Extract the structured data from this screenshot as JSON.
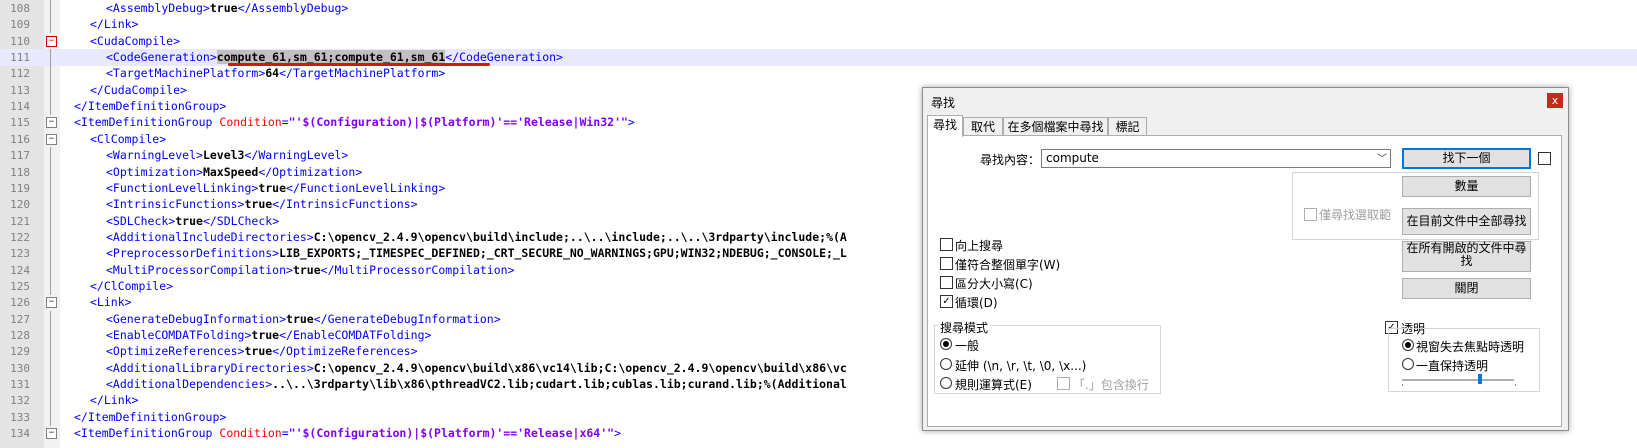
{
  "editor": {
    "lines": [
      {
        "num": "108",
        "indent": 3,
        "parts": [
          [
            "tag",
            "<AssemblyDebug>"
          ],
          [
            "txt",
            "true"
          ],
          [
            "tag",
            "</AssemblyDebug>"
          ]
        ]
      },
      {
        "num": "109",
        "indent": 2,
        "parts": [
          [
            "tag",
            "</Link>"
          ]
        ]
      },
      {
        "num": "110",
        "indent": 2,
        "fold": "−",
        "foldRed": true,
        "parts": [
          [
            "tag",
            "<CudaCompile>"
          ]
        ]
      },
      {
        "num": "111",
        "indent": 3,
        "active": true,
        "parts": [
          [
            "tag",
            "<CodeGeneration>"
          ],
          [
            "hl",
            "compute_61,sm_61;compute_61,sm_61"
          ],
          [
            "tag",
            "</CodeGeneration>"
          ]
        ]
      },
      {
        "num": "112",
        "indent": 3,
        "parts": [
          [
            "tag",
            "<TargetMachinePlatform>"
          ],
          [
            "txt",
            "64"
          ],
          [
            "tag",
            "</TargetMachinePlatform>"
          ]
        ]
      },
      {
        "num": "113",
        "indent": 2,
        "parts": [
          [
            "tag",
            "</CudaCompile>"
          ]
        ]
      },
      {
        "num": "114",
        "indent": 1,
        "parts": [
          [
            "tag",
            "</ItemDefinitionGroup>"
          ]
        ]
      },
      {
        "num": "115",
        "indent": 1,
        "fold": "−",
        "parts": [
          [
            "tag",
            "<ItemDefinitionGroup "
          ],
          [
            "attr",
            "Condition"
          ],
          [
            "tag",
            "="
          ],
          [
            "aval",
            "\"'$(Configuration)|$(Platform)'=='Release|Win32'\""
          ],
          [
            "tag",
            ">"
          ]
        ]
      },
      {
        "num": "116",
        "indent": 2,
        "fold": "−",
        "parts": [
          [
            "tag",
            "<ClCompile>"
          ]
        ]
      },
      {
        "num": "117",
        "indent": 3,
        "parts": [
          [
            "tag",
            "<WarningLevel>"
          ],
          [
            "txt",
            "Level3"
          ],
          [
            "tag",
            "</WarningLevel>"
          ]
        ]
      },
      {
        "num": "118",
        "indent": 3,
        "parts": [
          [
            "tag",
            "<Optimization>"
          ],
          [
            "txt",
            "MaxSpeed"
          ],
          [
            "tag",
            "</Optimization>"
          ]
        ]
      },
      {
        "num": "119",
        "indent": 3,
        "parts": [
          [
            "tag",
            "<FunctionLevelLinking>"
          ],
          [
            "txt",
            "true"
          ],
          [
            "tag",
            "</FunctionLevelLinking>"
          ]
        ]
      },
      {
        "num": "120",
        "indent": 3,
        "parts": [
          [
            "tag",
            "<IntrinsicFunctions>"
          ],
          [
            "txt",
            "true"
          ],
          [
            "tag",
            "</IntrinsicFunctions>"
          ]
        ]
      },
      {
        "num": "121",
        "indent": 3,
        "parts": [
          [
            "tag",
            "<SDLCheck>"
          ],
          [
            "txt",
            "true"
          ],
          [
            "tag",
            "</SDLCheck>"
          ]
        ]
      },
      {
        "num": "122",
        "indent": 3,
        "parts": [
          [
            "tag",
            "<AdditionalIncludeDirectories>"
          ],
          [
            "txt",
            "C:\\opencv_2.4.9\\opencv\\build\\include;..\\..\\include;..\\..\\3rdparty\\include;%(A"
          ]
        ]
      },
      {
        "num": "123",
        "indent": 3,
        "parts": [
          [
            "tag",
            "<PreprocessorDefinitions>"
          ],
          [
            "txt",
            "LIB_EXPORTS;_TIMESPEC_DEFINED;_CRT_SECURE_NO_WARNINGS;GPU;WIN32;NDEBUG;_CONSOLE;_L"
          ]
        ]
      },
      {
        "num": "124",
        "indent": 3,
        "parts": [
          [
            "tag",
            "<MultiProcessorCompilation>"
          ],
          [
            "txt",
            "true"
          ],
          [
            "tag",
            "</MultiProcessorCompilation>"
          ]
        ]
      },
      {
        "num": "125",
        "indent": 2,
        "parts": [
          [
            "tag",
            "</ClCompile>"
          ]
        ]
      },
      {
        "num": "126",
        "indent": 2,
        "fold": "−",
        "parts": [
          [
            "tag",
            "<Link>"
          ]
        ]
      },
      {
        "num": "127",
        "indent": 3,
        "parts": [
          [
            "tag",
            "<GenerateDebugInformation>"
          ],
          [
            "txt",
            "true"
          ],
          [
            "tag",
            "</GenerateDebugInformation>"
          ]
        ]
      },
      {
        "num": "128",
        "indent": 3,
        "parts": [
          [
            "tag",
            "<EnableCOMDATFolding>"
          ],
          [
            "txt",
            "true"
          ],
          [
            "tag",
            "</EnableCOMDATFolding>"
          ]
        ]
      },
      {
        "num": "129",
        "indent": 3,
        "parts": [
          [
            "tag",
            "<OptimizeReferences>"
          ],
          [
            "txt",
            "true"
          ],
          [
            "tag",
            "</OptimizeReferences>"
          ]
        ]
      },
      {
        "num": "130",
        "indent": 3,
        "parts": [
          [
            "tag",
            "<AdditionalLibraryDirectories>"
          ],
          [
            "txt",
            "C:\\opencv_2.4.9\\opencv\\build\\x86\\vc14\\lib;C:\\opencv_2.4.9\\opencv\\build\\x86\\vc"
          ]
        ]
      },
      {
        "num": "131",
        "indent": 3,
        "parts": [
          [
            "tag",
            "<AdditionalDependencies>"
          ],
          [
            "txt",
            "..\\..\\3rdparty\\lib\\x86\\pthreadVC2.lib;cudart.lib;cublas.lib;curand.lib;%(Additional"
          ]
        ]
      },
      {
        "num": "132",
        "indent": 2,
        "parts": [
          [
            "tag",
            "</Link>"
          ]
        ]
      },
      {
        "num": "133",
        "indent": 1,
        "parts": [
          [
            "tag",
            "</ItemDefinitionGroup>"
          ]
        ]
      },
      {
        "num": "134",
        "indent": 1,
        "fold": "−",
        "parts": [
          [
            "tag",
            "<ItemDefinitionGroup "
          ],
          [
            "attr",
            "Condition"
          ],
          [
            "tag",
            "="
          ],
          [
            "aval",
            "\"'$(Configuration)|$(Platform)'=='Release|x64'\""
          ],
          [
            "tag",
            ">"
          ]
        ]
      }
    ]
  },
  "dialog": {
    "title": "尋找",
    "close": "x",
    "tabs": [
      "尋找",
      "取代",
      "在多個檔案中尋找",
      "標記"
    ],
    "find_label": "尋找內容：",
    "find_value": "compute",
    "buttons": {
      "find_next": "找下一個",
      "count": "數量",
      "find_all_current": "在目前文件中全部尋找",
      "find_all_open": "在所有開啟的文件中尋找",
      "close": "關閉"
    },
    "in_selection": "僅尋找選取範",
    "options": {
      "backward": "向上搜尋",
      "whole_word": "僅符合整個單字(W)",
      "match_case": "區分大小寫(C)",
      "wrap": "循環(D)"
    },
    "search_mode": {
      "title": "搜尋模式",
      "normal": "一般",
      "extended": "延伸 (\\n, \\r, \\t, \\0, \\x...)",
      "regex": "規則運算式(E)",
      "dot_newline": "「.」包含換行"
    },
    "transparency": {
      "title": "透明",
      "on_lose_focus": "視窗失去焦點時透明",
      "always": "一直保持透明",
      "level": 0.7
    }
  }
}
